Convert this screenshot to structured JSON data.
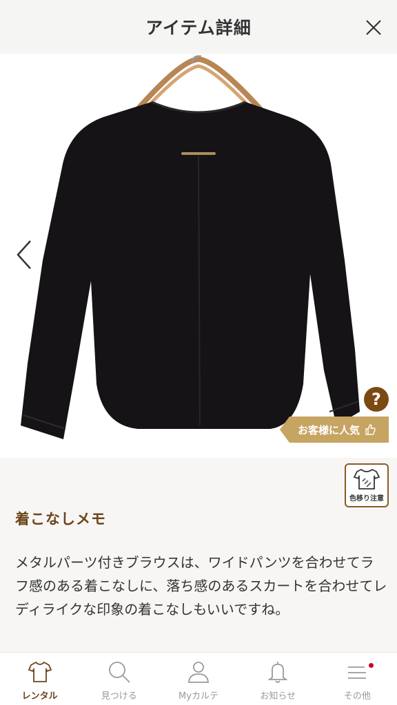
{
  "header": {
    "title": "アイテム詳細"
  },
  "product": {
    "popular_badge": "お客様に人気",
    "help_symbol": "?",
    "care_label": "色移り注意"
  },
  "memo": {
    "title": "着こなしメモ",
    "text": "メタルパーツ付きブラウスは、ワイドパンツを合わせてラフ感のある着こなしに、落ち感のあるスカートを合わせてレディライクな印象の着こなしもいいですね。"
  },
  "tabs": [
    {
      "label": "レンタル",
      "icon": "tshirt-icon",
      "active": true
    },
    {
      "label": "見つける",
      "icon": "search-icon",
      "active": false
    },
    {
      "label": "Myカルテ",
      "icon": "user-icon",
      "active": false
    },
    {
      "label": "お知らせ",
      "icon": "bell-icon",
      "active": false
    },
    {
      "label": "その他",
      "icon": "menu-icon",
      "active": false,
      "badge": true
    }
  ],
  "colors": {
    "accent_brown": "#6b4418",
    "badge_gold": "#c6a461",
    "notify_red": "#d0021b"
  }
}
